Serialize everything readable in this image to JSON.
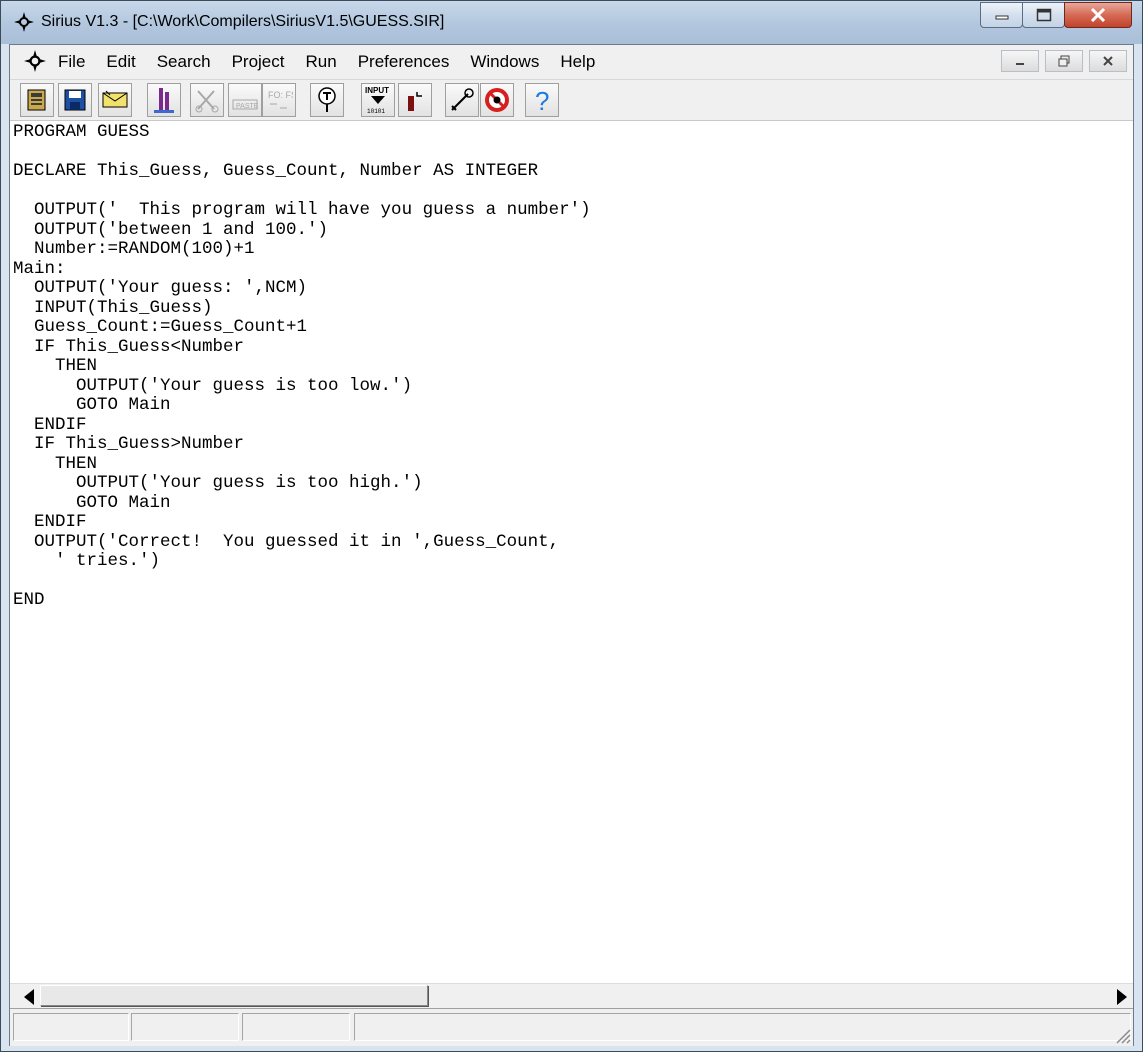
{
  "window": {
    "title": "Sirius V1.3 - [C:\\Work\\Compilers\\SiriusV1.5\\GUESS.SIR]"
  },
  "menu": {
    "items": [
      "File",
      "Edit",
      "Search",
      "Project",
      "Run",
      "Preferences",
      "Windows",
      "Help"
    ]
  },
  "toolbar": {
    "buttons": [
      {
        "name": "open-file-icon",
        "enabled": true
      },
      {
        "name": "save-icon",
        "enabled": true
      },
      {
        "name": "mail-icon",
        "enabled": true
      },
      {
        "name": "compile-icon",
        "enabled": true
      },
      {
        "name": "cut-icon",
        "enabled": false
      },
      {
        "name": "paste-icon",
        "enabled": false,
        "label": "PASTE"
      },
      {
        "name": "fo-fs-icon",
        "enabled": false,
        "label": "FO: FS"
      },
      {
        "name": "trace-icon",
        "enabled": true
      },
      {
        "name": "input-icon",
        "enabled": true,
        "label": "INPUT",
        "sublabel": "10101"
      },
      {
        "name": "step-icon",
        "enabled": true
      },
      {
        "name": "tools-icon",
        "enabled": true
      },
      {
        "name": "stop-debug-icon",
        "enabled": true
      },
      {
        "name": "help-icon",
        "enabled": true,
        "label": "?"
      }
    ]
  },
  "editor": {
    "lines": [
      "PROGRAM GUESS",
      "",
      "DECLARE This_Guess, Guess_Count, Number AS INTEGER",
      "",
      "  OUTPUT('  This program will have you guess a number')",
      "  OUTPUT('between 1 and 100.')",
      "  Number:=RANDOM(100)+1",
      "Main:",
      "  OUTPUT('Your guess: ',NCM)",
      "  INPUT(This_Guess)",
      "  Guess_Count:=Guess_Count+1",
      "  IF This_Guess<Number",
      "    THEN",
      "      OUTPUT('Your guess is too low.')",
      "      GOTO Main",
      "  ENDIF",
      "  IF This_Guess>Number",
      "    THEN",
      "      OUTPUT('Your guess is too high.')",
      "      GOTO Main",
      "  ENDIF",
      "  OUTPUT('Correct!  You guessed it in ',Guess_Count,",
      "    ' tries.')",
      "",
      "END"
    ]
  },
  "statusbar": {
    "panels": [
      "",
      "",
      "",
      ""
    ]
  },
  "colors": {
    "close_button": "#c8452d",
    "help_icon": "#1b7de0",
    "stop_icon": "#d62020"
  }
}
